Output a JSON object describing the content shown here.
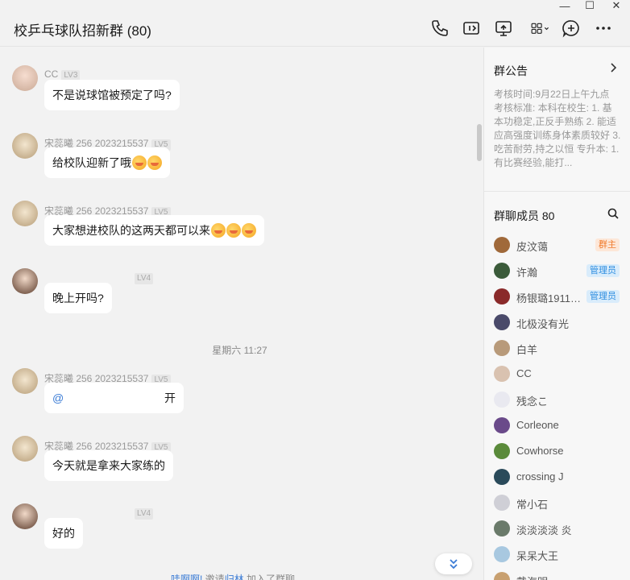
{
  "window": {
    "title": "校乒乓球队招新群 (80)",
    "minimize": "—",
    "maximize": "☐",
    "close": "✕"
  },
  "toolbar": {
    "icons": [
      "phone-icon",
      "video-icon",
      "screen-share-icon",
      "apps-icon",
      "add-member-icon",
      "more-icon"
    ]
  },
  "chat": {
    "messages": [
      {
        "sender": "CC",
        "level": "LV3",
        "text": "不是说球馆被预定了吗?"
      },
      {
        "sender": "宋蕊曦 256 2023215537",
        "level": "LV5",
        "text": "给校队迎新了哦"
      },
      {
        "sender": "宋蕊曦 256 2023215537",
        "level": "LV5",
        "text": "大家想进校队的这两天都可以来"
      },
      {
        "sender": "",
        "level": "LV4",
        "text": "晚上开吗?"
      },
      {
        "sender": "宋蕊曦 256 2023215537",
        "level": "LV5",
        "text_prefix": "@",
        "text": "开"
      },
      {
        "sender": "宋蕊曦 256 2023215537",
        "level": "LV5",
        "text": "今天就是拿来大家练的"
      },
      {
        "sender": "",
        "level": "LV4",
        "text": "好的"
      }
    ],
    "timestamp": "星期六 11:27",
    "system": {
      "name1": "哇啊啊!",
      "middle": " 邀请",
      "name2": "归林",
      "suffix": " 加入了群聊。"
    }
  },
  "sidebar": {
    "notice_title": "群公告",
    "notice_text": "考核时间:9月22日上午九点 考核标准: 本科在校生: 1. 基本功稳定,正反手熟练 2. 能适应高强度训练身体素质较好 3.吃苦耐劳,持之以恒 专升本: 1.有比赛经验,能打...",
    "members_title": "群聊成员 80",
    "members": [
      {
        "name": "皮汶蔼",
        "badge": "群主",
        "badge_type": "owner",
        "color": "#a0693a"
      },
      {
        "name": "许瀚",
        "badge": "管理员",
        "badge_type": "admin",
        "color": "#3b5b3a"
      },
      {
        "name": "杨银璐19112...",
        "badge": "管理员",
        "badge_type": "admin",
        "color": "#8a2a2a"
      },
      {
        "name": "北极没有光",
        "badge": "",
        "badge_type": "",
        "color": "#4a4a6a"
      },
      {
        "name": "白羊",
        "badge": "",
        "badge_type": "",
        "color": "#b89a7a"
      },
      {
        "name": "CC",
        "badge": "",
        "badge_type": "",
        "color": "#d9c2b0"
      },
      {
        "name": "残念こ",
        "badge": "",
        "badge_type": "",
        "color": "#e9e9f0"
      },
      {
        "name": "Corleone",
        "badge": "",
        "badge_type": "",
        "color": "#6a4a8a"
      },
      {
        "name": "Cowhorse",
        "badge": "",
        "badge_type": "",
        "color": "#5a8a3a"
      },
      {
        "name": "crossing J",
        "badge": "",
        "badge_type": "",
        "color": "#2a4a5a"
      },
      {
        "name": "常小石",
        "badge": "",
        "badge_type": "",
        "color": "#cfcfd6"
      },
      {
        "name": "淡淡淡淡 炎",
        "badge": "",
        "badge_type": "",
        "color": "#6a7a6a"
      },
      {
        "name": "呆呆大王",
        "badge": "",
        "badge_type": "",
        "color": "#a8c8e0"
      },
      {
        "name": "戴海明",
        "badge": "",
        "badge_type": "",
        "color": "#c8a070"
      }
    ]
  }
}
